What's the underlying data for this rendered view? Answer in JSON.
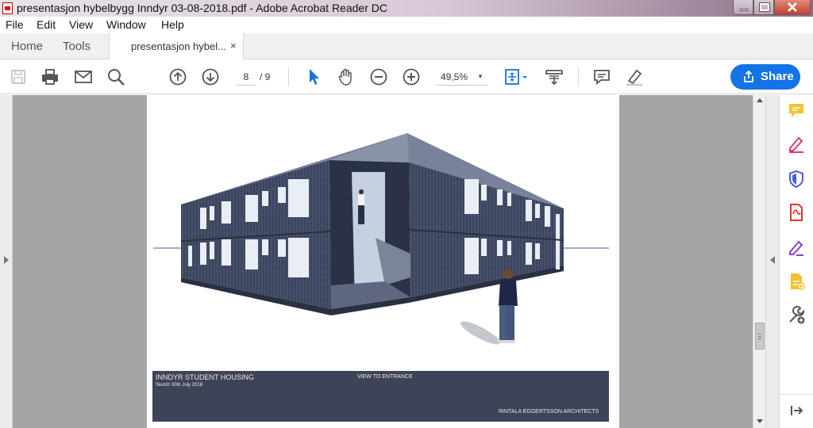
{
  "window": {
    "title": "presentasjon hybelbygg Inndyr 03-08-2018.pdf - Adobe Acrobat Reader DC"
  },
  "menu": {
    "items": [
      "File",
      "Edit",
      "View",
      "Window",
      "Help"
    ]
  },
  "tabs": {
    "home": "Home",
    "tools": "Tools",
    "document": "presentasjon hybel...",
    "close_glyph": "×"
  },
  "toolbar": {
    "current_page": "8",
    "page_separator": "/ 9",
    "zoom": "49,5%",
    "share_label": "Share",
    "accent_color": "#1473e6",
    "icons": [
      "save-icon",
      "print-icon",
      "email-icon",
      "search-icon",
      "previous-page-icon",
      "next-page-icon",
      "select-cursor-icon",
      "hand-icon",
      "zoom-out-icon",
      "zoom-in-icon",
      "fit-page-icon",
      "scroll-mode-icon",
      "comment-icon",
      "highlight-pen-icon",
      "share-icon"
    ]
  },
  "document": {
    "caption_title": "INNDYR STUDENT HOUSING",
    "caption_date": "Sketch 30th July 2018",
    "caption_view": "VIEW TO ENTRANCE",
    "caption_architect": "RINTALA EGGERTSSON ARCHITECTS"
  },
  "tools_pane": {
    "icons": [
      "comment-tool-icon",
      "fill-sign-icon",
      "protect-icon",
      "export-pdf-icon",
      "fill-sign-pen-icon",
      "create-pdf-icon",
      "more-tools-icon",
      "collapse-pane-icon"
    ]
  }
}
